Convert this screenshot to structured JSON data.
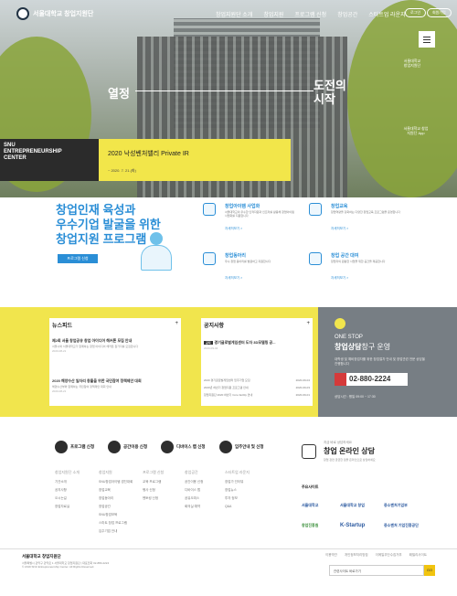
{
  "header": {
    "logo_text": "서울대학교 창업지원단",
    "nav": [
      "창업지원단 소개",
      "창업지원",
      "프로그램 신청",
      "창업공간",
      "스타트업 라운지"
    ],
    "login_label": "로그인",
    "signup_label": "회원가입"
  },
  "hero": {
    "left_text": "열정",
    "right_text": "도전의\n시작",
    "side_vertical": "서울대학교 창업지원단",
    "app_label": "서울대학교 창업지원단 App",
    "card": {
      "ent": "SNU\nENTREPRENEURSHIP\nCENTER",
      "title": "2020 낙성벤처밸리 Private IR",
      "date": "~ 2020. 7. 21.(화)"
    }
  },
  "intro": {
    "line1_em": "창업",
    "line1": "인재 육성과",
    "line2": "우수기업 발굴을 위한",
    "line3": "창업지원 프로그램",
    "button": "프로그램 신청"
  },
  "services": [
    {
      "title": "창업아이템 사업화",
      "desc": "서울대학교의 우수한 인적자원과 인프라를 활용해 창업아이템 사업화를 지원합니다",
      "more": "자세히보기 >"
    },
    {
      "title": "창업교육",
      "desc": "창업역량을 강화하는 다양한 창업교육 프로그램을 운영합니다",
      "more": "자세히보기 >"
    },
    {
      "title": "창업동아리",
      "desc": "우수 창업 동아리를 발굴하고 지원합니다",
      "more": "자세히보기 >"
    },
    {
      "title": "창업 공간 대여",
      "desc": "창업자의 원활한 사업을 위한 공간을 제공합니다",
      "more": "자세히보기 >"
    }
  ],
  "news": {
    "heading": "뉴스피드",
    "more": "+",
    "items": [
      {
        "title": "제2회 서울 창업공유 창업 아이디어 해커톤 모집 안내",
        "desc": "서울시와 서울대학교가 함께하는 창업 아이디어 해커톤 참가자를 모집합니다",
        "date": "2020-08-21"
      },
      {
        "title": "2020 해양수산 일자리 창출을 위한 국민참여 정책제안 대회",
        "desc": "해양수산부와 함께하는 국민참여 정책제안 대회 안내",
        "date": "2020-08-21"
      }
    ]
  },
  "notice": {
    "heading": "공지사항",
    "more": "+",
    "badge": "공지",
    "top": "경기글로벌게임센터 도자 3D모델링 공...",
    "top_date": "2020-09-04",
    "rows": [
      {
        "t": "2020 경기글로벌게임센터 입주기업 모집",
        "d": "2020-09-04"
      },
      {
        "t": "2020년 하반기 창업지원 프로그램 안내",
        "d": "2020-09-03"
      },
      {
        "t": "창업지원단 2020 하반기 Core facility 안내",
        "d": "2020-09-01"
      }
    ]
  },
  "onestop": {
    "l1": "ONE STOP",
    "l2a": "창업상담",
    "l2b": "창구 운영",
    "desc": "대학생 및 예비창업자를 위한 창업절차 안내 및 창업관련 전문 상담을 진행합니다",
    "phone": "02-880-2224",
    "hours": "상담시간 : 평일 09:00 ~ 17:30"
  },
  "quick": [
    "프로그램 신청",
    "공간이용 신청",
    "디바이스 랩 신청",
    "입주안내 및 신청"
  ],
  "links": [
    {
      "h": "창업지원단 소개",
      "items": [
        "기관소개",
        "공지사항",
        "오시는길",
        "창업자료실"
      ]
    },
    {
      "h": "창업지원",
      "items": [
        "SNU창업아이템 경진대회",
        "창업교육",
        "창업동아리",
        "창업공간",
        "SNU창업보육",
        "스마트 창업 프로그램",
        "입주기업 안내"
      ]
    },
    {
      "h": "프로그램 신청",
      "items": [
        "교육 프로그램",
        "행사 신청",
        "멘토링 신청"
      ]
    },
    {
      "h": "창업공간",
      "items": [
        "공간이용 신청",
        "디바이스 랩",
        "공유오피스",
        "회의실 예약"
      ]
    },
    {
      "h": "스타트업 라운지",
      "items": [
        "창업가 인터뷰",
        "창업뉴스",
        "투자 정보",
        "Q&A"
      ]
    }
  ],
  "consult": {
    "sub": "지금 바로 상담하세요",
    "title": "창업 온라인 상담",
    "desc": "창업 관련 궁금한 점을 온라인으로 상담하세요"
  },
  "partners": {
    "heading": "주요사이트",
    "logos": [
      "서울대학교",
      "서울대학교 창업",
      "중소벤처기업부",
      "창업진흥원",
      "K-Startup",
      "중소벤처 기업진흥공단"
    ]
  },
  "footer": {
    "org": "서울대학교 창업지원단",
    "addr": "서울특별시 관악구 관악로 1 서울대학교 창업지원단 | 대표전화 02-880-2224",
    "copy": "© 2019 SNU Entrepreneurship Center. All Rights Reserved.",
    "links": [
      "이용약관",
      "개인정보처리방침",
      "이메일무단수집거부",
      "패밀리사이트"
    ],
    "select": "관련사이트 바로가기",
    "go": "GO"
  },
  "colors": {
    "accent_blue": "#2a8ed6",
    "accent_yellow": "#f1e54d",
    "dark": "#2b2b2b"
  }
}
